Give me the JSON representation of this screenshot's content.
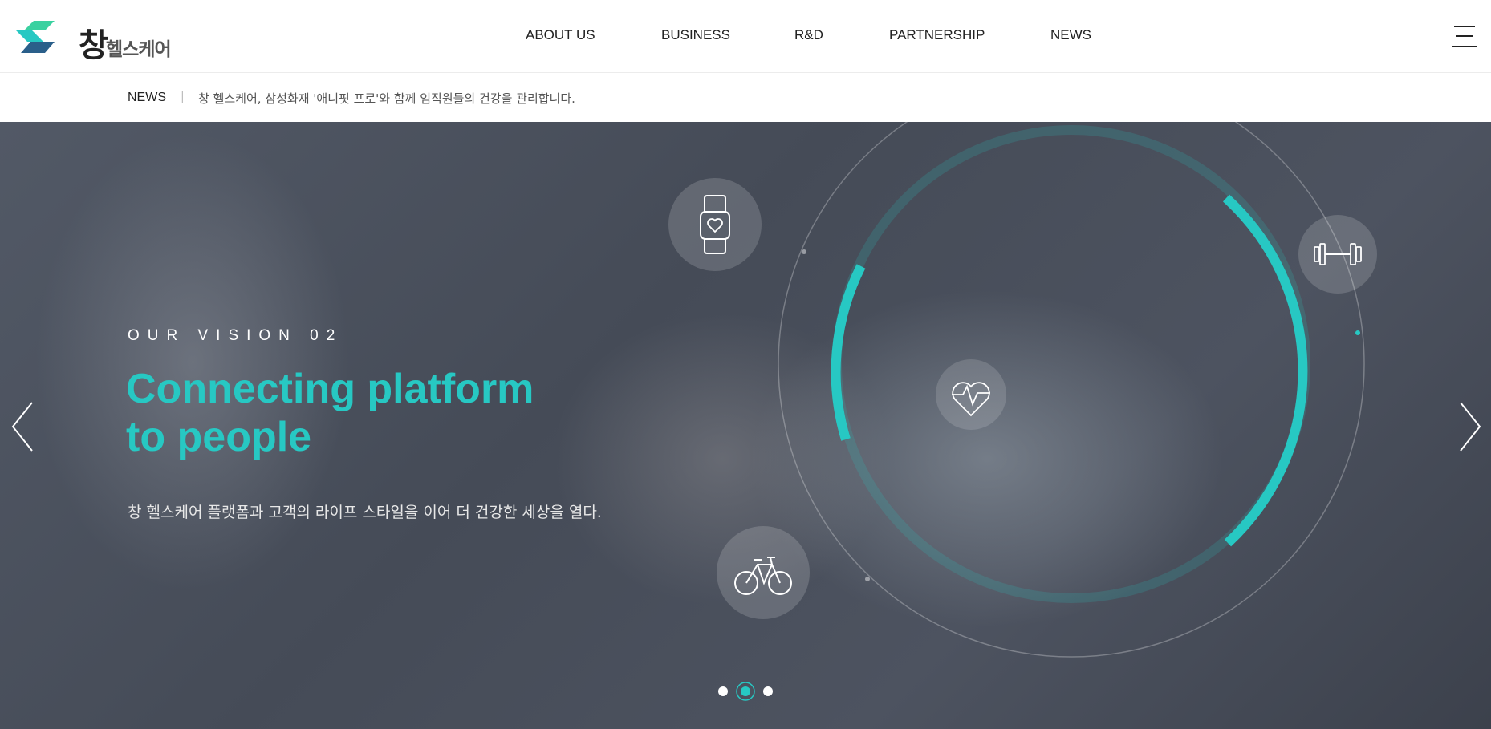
{
  "brand": {
    "name": "창",
    "sub": "헬스케어",
    "colors": {
      "teal": "#27c8c3",
      "green": "#3ad1a0",
      "navy": "#2a5f8a"
    }
  },
  "nav": {
    "items": [
      "ABOUT US",
      "BUSINESS",
      "R&D",
      "PARTNERSHIP",
      "NEWS"
    ]
  },
  "ticker": {
    "label": "NEWS",
    "separator": "|",
    "text": "창 헬스케어, 삼성화재 '애니핏 프로'와 함께 임직원들의 건강을 관리합니다."
  },
  "hero": {
    "eyebrow": "OUR VISION 02",
    "title_line1": "Connecting platform",
    "title_line2": "to people",
    "subtitle": "창 헬스케어 플랫폼과 고객의 라이프 스타일을 이어 더 건강한 세상을 열다.",
    "accent_color": "#27c8c3",
    "icons": [
      "smartwatch-icon",
      "dumbbell-icon",
      "heart-pulse-icon",
      "bicycle-icon"
    ],
    "slides": {
      "count": 3,
      "active": 2
    }
  }
}
